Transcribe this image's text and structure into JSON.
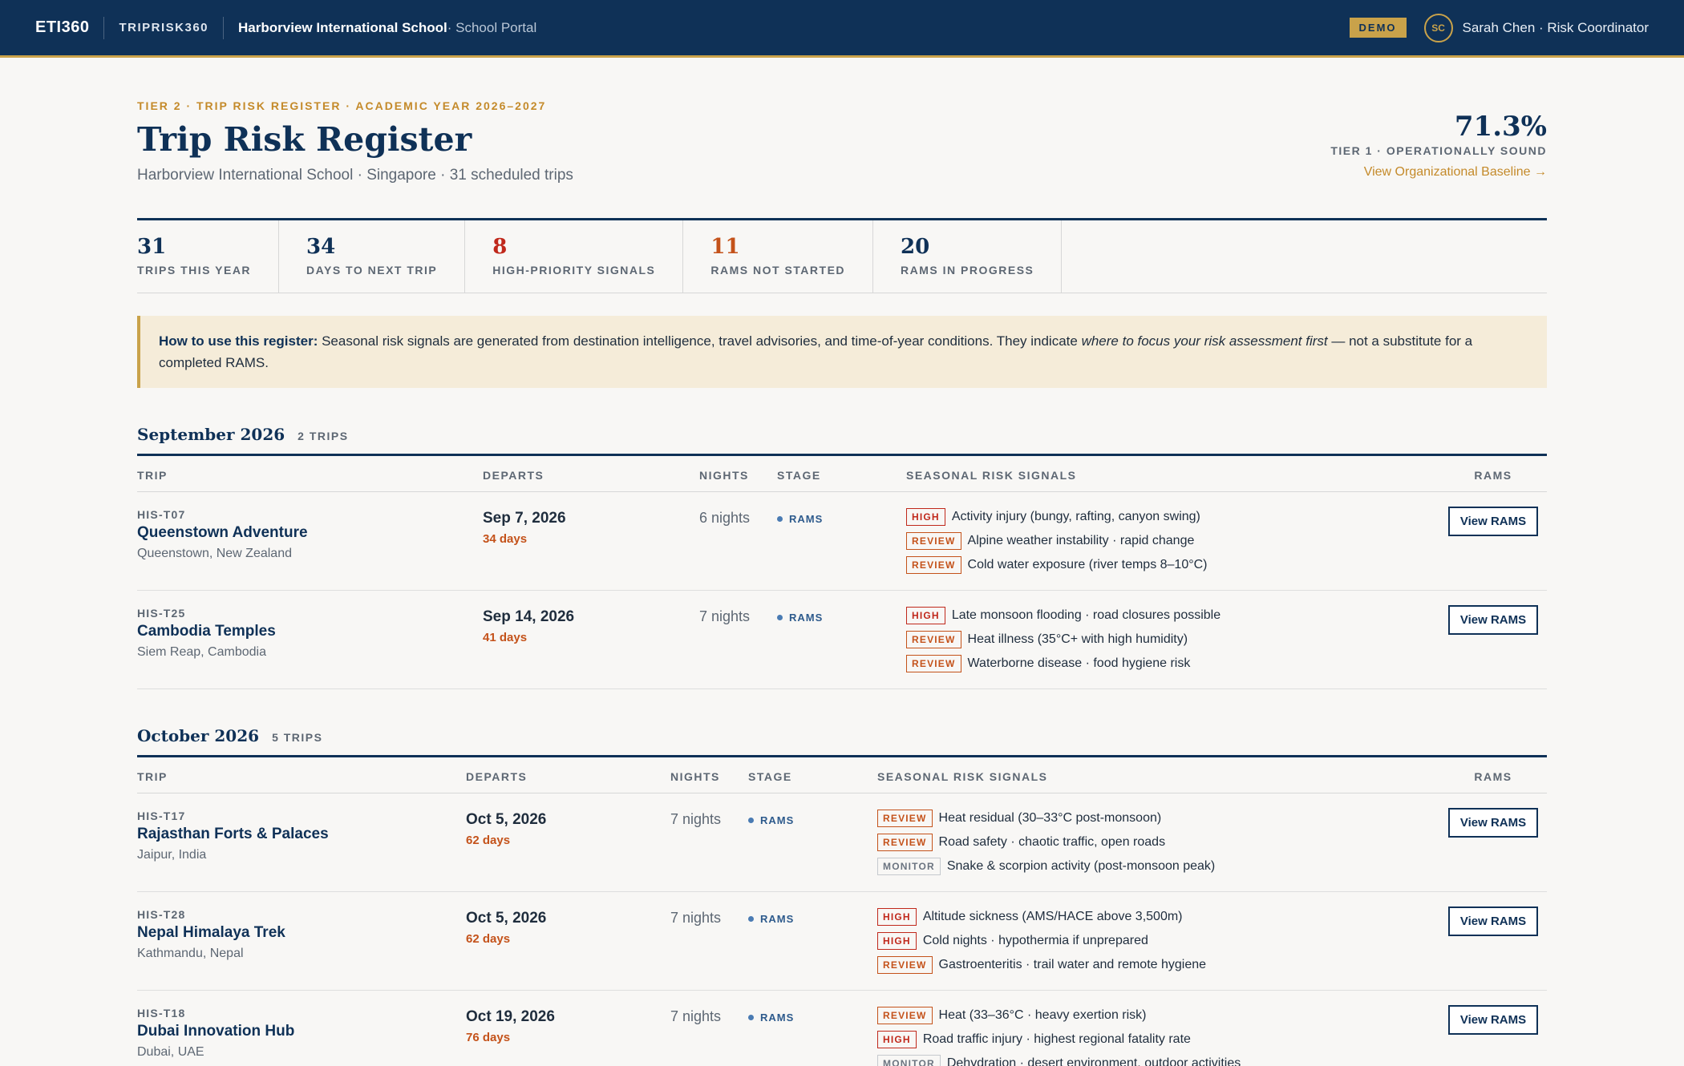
{
  "nav": {
    "logo": "ETI360",
    "product": "TRIPRISK360",
    "school": "Harborview International School",
    "school_sub": " · School Portal",
    "demo": "DEMO",
    "avatar": "SC",
    "user": "Sarah Chen · Risk Coordinator"
  },
  "header": {
    "eyebrow": "TIER 2 · TRIP RISK REGISTER · ACADEMIC YEAR 2026–2027",
    "title": "Trip Risk Register",
    "subtitle": "Harborview International School · Singapore · 31 scheduled trips",
    "score": "71.3%",
    "score_label": "TIER 1 · OPERATIONALLY SOUND",
    "baseline_link": "View Organizational Baseline →"
  },
  "stats": [
    {
      "value": "31",
      "label": "TRIPS THIS YEAR",
      "tone": ""
    },
    {
      "value": "34",
      "label": "DAYS TO NEXT TRIP",
      "tone": ""
    },
    {
      "value": "8",
      "label": "HIGH-PRIORITY SIGNALS",
      "tone": "red"
    },
    {
      "value": "11",
      "label": "RAMS NOT STARTED",
      "tone": "orange"
    },
    {
      "value": "20",
      "label": "RAMS IN PROGRESS",
      "tone": ""
    }
  ],
  "note": {
    "lead": "How to use this register:",
    "text1": " Seasonal risk signals are generated from destination intelligence, travel advisories, and time-of-year conditions. They indicate ",
    "emph": "where to focus your risk assessment first",
    "text2": " — not a substitute for a completed RAMS."
  },
  "columns": {
    "trip": "TRIP",
    "departs": "DEPARTS",
    "nights": "NIGHTS",
    "stage": "STAGE",
    "signals": "SEASONAL RISK SIGNALS",
    "rams": "RAMS"
  },
  "months": [
    {
      "title": "September 2026",
      "count": "2 TRIPS",
      "trips": [
        {
          "id": "HIS-T07",
          "name": "Queenstown Adventure",
          "location": "Queenstown, New Zealand",
          "date": "Sep 7, 2026",
          "days": "34 days",
          "nights": "6 nights",
          "stage": "RAMS",
          "button": "View RAMS",
          "signals": [
            {
              "level": "HIGH",
              "kind": "high",
              "text": "Activity injury (bungy, rafting, canyon swing)"
            },
            {
              "level": "REVIEW",
              "kind": "review",
              "text": "Alpine weather instability · rapid change"
            },
            {
              "level": "REVIEW",
              "kind": "review",
              "text": "Cold water exposure (river temps 8–10°C)"
            }
          ]
        },
        {
          "id": "HIS-T25",
          "name": "Cambodia Temples",
          "location": "Siem Reap, Cambodia",
          "date": "Sep 14, 2026",
          "days": "41 days",
          "nights": "7 nights",
          "stage": "RAMS",
          "button": "View RAMS",
          "signals": [
            {
              "level": "HIGH",
              "kind": "high",
              "text": "Late monsoon flooding · road closures possible"
            },
            {
              "level": "REVIEW",
              "kind": "review",
              "text": "Heat illness (35°C+ with high humidity)"
            },
            {
              "level": "REVIEW",
              "kind": "review",
              "text": "Waterborne disease · food hygiene risk"
            }
          ]
        }
      ]
    },
    {
      "title": "October 2026",
      "count": "5 TRIPS",
      "trips": [
        {
          "id": "HIS-T17",
          "name": "Rajasthan Forts & Palaces",
          "location": "Jaipur, India",
          "date": "Oct 5, 2026",
          "days": "62 days",
          "nights": "7 nights",
          "stage": "RAMS",
          "button": "View RAMS",
          "signals": [
            {
              "level": "REVIEW",
              "kind": "review",
              "text": "Heat residual (30–33°C post-monsoon)"
            },
            {
              "level": "REVIEW",
              "kind": "review",
              "text": "Road safety · chaotic traffic, open roads"
            },
            {
              "level": "MONITOR",
              "kind": "monitor",
              "text": "Snake & scorpion activity (post-monsoon peak)"
            }
          ]
        },
        {
          "id": "HIS-T28",
          "name": "Nepal Himalaya Trek",
          "location": "Kathmandu, Nepal",
          "date": "Oct 5, 2026",
          "days": "62 days",
          "nights": "7 nights",
          "stage": "RAMS",
          "button": "View RAMS",
          "signals": [
            {
              "level": "HIGH",
              "kind": "high",
              "text": "Altitude sickness (AMS/HACE above 3,500m)"
            },
            {
              "level": "HIGH",
              "kind": "high",
              "text": "Cold nights · hypothermia if unprepared"
            },
            {
              "level": "REVIEW",
              "kind": "review",
              "text": "Gastroenteritis · trail water and remote hygiene"
            }
          ]
        },
        {
          "id": "HIS-T18",
          "name": "Dubai Innovation Hub",
          "location": "Dubai, UAE",
          "date": "Oct 19, 2026",
          "days": "76 days",
          "nights": "7 nights",
          "stage": "RAMS",
          "button": "View RAMS",
          "signals": [
            {
              "level": "REVIEW",
              "kind": "review",
              "text": "Heat (33–36°C · heavy exertion risk)"
            },
            {
              "level": "HIGH",
              "kind": "high",
              "text": "Road traffic injury · highest regional fatality rate"
            },
            {
              "level": "MONITOR",
              "kind": "monitor",
              "text": "Dehydration · desert environment, outdoor activities"
            }
          ]
        }
      ]
    }
  ]
}
